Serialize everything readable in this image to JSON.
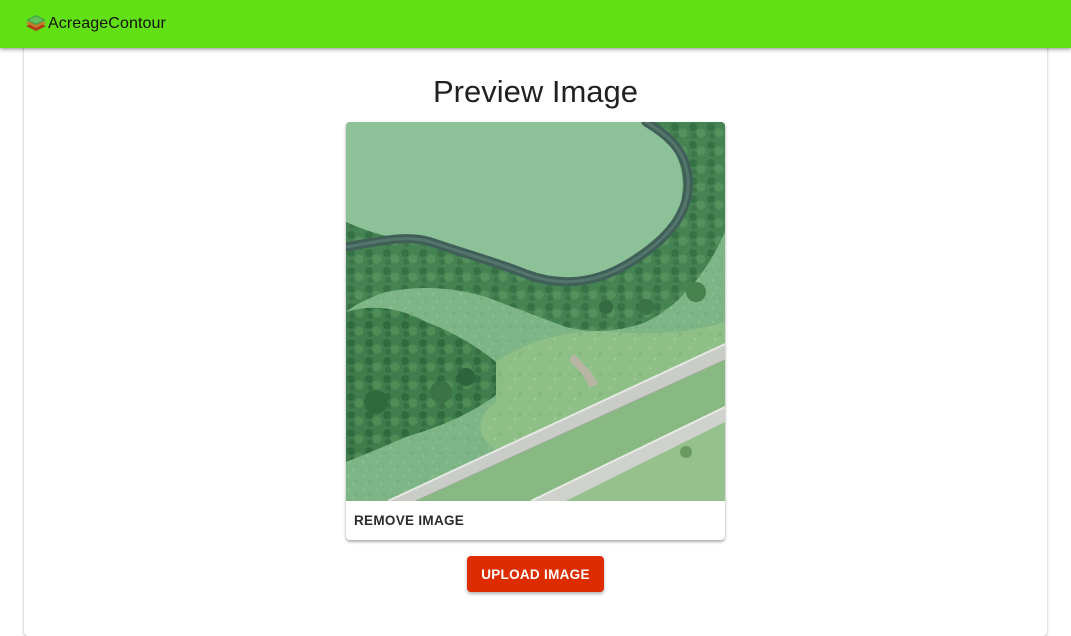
{
  "app_bar": {
    "brand_name": "AcreageContour",
    "logo_icon": "layered-land-icon",
    "background_color": "#62e016"
  },
  "page": {
    "title": "Preview Image"
  },
  "preview": {
    "image_icon": "aerial-farmland-photo",
    "remove_label": "REMOVE IMAGE"
  },
  "actions": {
    "upload_label": "UPLOAD IMAGE",
    "upload_color": "#dd2c00"
  }
}
